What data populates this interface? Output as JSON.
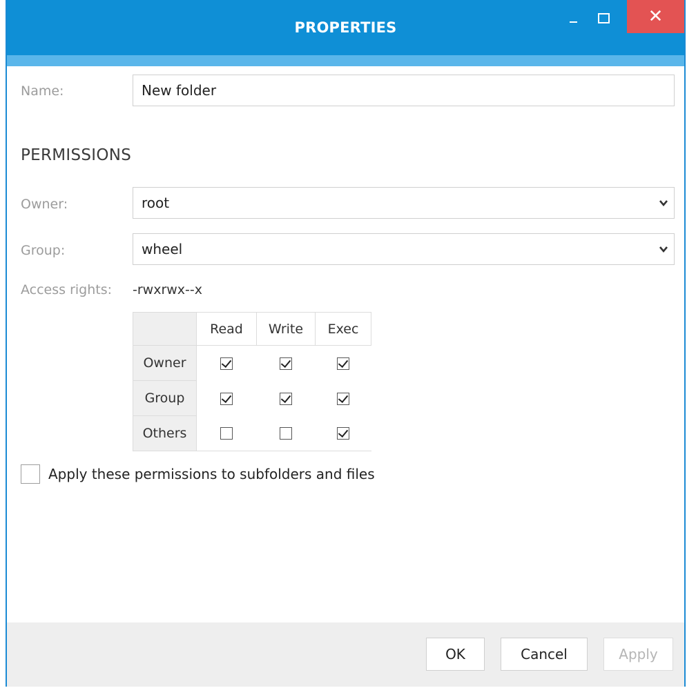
{
  "window": {
    "title": "PROPERTIES",
    "controls": {
      "minimize": "minimize-icon",
      "maximize": "maximize-icon",
      "close": "close-icon"
    },
    "colors": {
      "titlebar": "#0f8fd6",
      "subbar": "#5ab6ea",
      "close": "#e35353"
    }
  },
  "name_field": {
    "label": "Name:",
    "value": "New folder"
  },
  "permissions": {
    "section_title": "PERMISSIONS",
    "owner": {
      "label": "Owner:",
      "value": "root"
    },
    "group": {
      "label": "Group:",
      "value": "wheel"
    },
    "access_rights": {
      "label": "Access rights:",
      "value": "-rwxrwx--x"
    },
    "table": {
      "columns": [
        "Read",
        "Write",
        "Exec"
      ],
      "rows": [
        {
          "label": "Owner",
          "checks": [
            true,
            true,
            true
          ]
        },
        {
          "label": "Group",
          "checks": [
            true,
            true,
            true
          ]
        },
        {
          "label": "Others",
          "checks": [
            false,
            false,
            true
          ]
        }
      ]
    }
  },
  "apply_subfolders": {
    "label": "Apply these permissions to subfolders and files",
    "checked": false
  },
  "buttons": {
    "ok": "OK",
    "cancel": "Cancel",
    "apply": "Apply"
  }
}
